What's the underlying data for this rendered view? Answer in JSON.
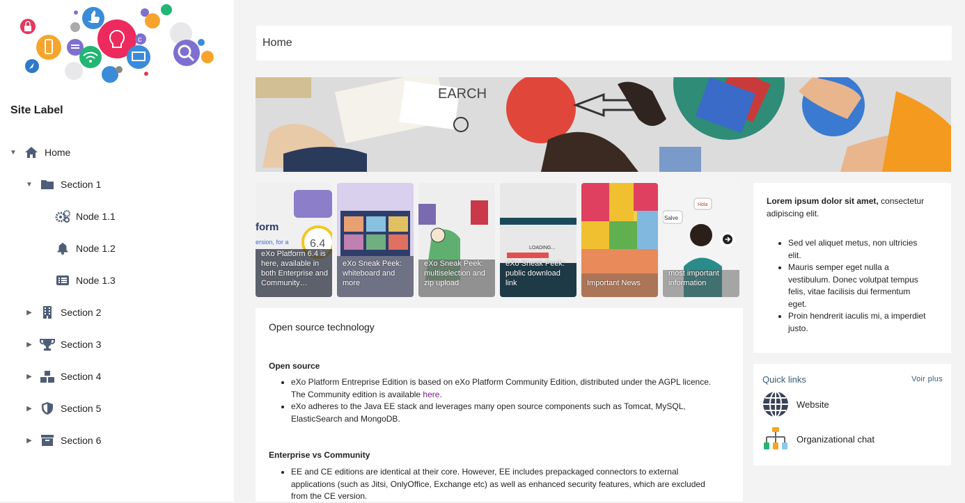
{
  "sidebar": {
    "site_label": "Site Label",
    "items": [
      {
        "label": "Home",
        "icon": "home-icon",
        "caret": "expanded"
      },
      {
        "label": "Section 1",
        "icon": "folder-icon",
        "caret": "expanded"
      },
      {
        "label": "Node 1.1",
        "icon": "gears-icon",
        "caret": "none"
      },
      {
        "label": "Node 1.2",
        "icon": "bell-icon",
        "caret": "none"
      },
      {
        "label": "Node 1.3",
        "icon": "list-icon",
        "caret": "none"
      },
      {
        "label": "Section 2",
        "icon": "building-icon",
        "caret": "collapsed"
      },
      {
        "label": "Section 3",
        "icon": "trophy-icon",
        "caret": "collapsed"
      },
      {
        "label": "Section 4",
        "icon": "boxes-icon",
        "caret": "collapsed"
      },
      {
        "label": "Section 5",
        "icon": "shield-icon",
        "caret": "collapsed"
      },
      {
        "label": "Section 6",
        "icon": "archive-icon",
        "caret": "collapsed"
      }
    ]
  },
  "page": {
    "title": "Home"
  },
  "news": [
    {
      "text": "eXo Platform 6.4 is here, available in both Enterprise and Community…",
      "overlay_text": [
        "form",
        "ersion, for a",
        "6.4"
      ]
    },
    {
      "text": "eXo Sneak Peek: whiteboard and more"
    },
    {
      "text": "eXo Sneak Peek: multiselection and zip upload"
    },
    {
      "text": "eXo Sneak Peek: public download link",
      "overlay_text": [
        "LOADING..."
      ]
    },
    {
      "text": "Important News"
    },
    {
      "text": "most important information",
      "overlay_text": [
        "Salve",
        "Hola"
      ]
    }
  ],
  "banner": {
    "overlay_text": "EARCH"
  },
  "article": {
    "title": "Open source technology",
    "h1": "Open source",
    "b1_pre": "eXo Platform Entreprise Edition is based on eXo Platform Community Edition, distributed under the AGPL licence. The Community edition is available ",
    "b1_link": "here",
    "b1_post": ".",
    "b2": "eXo adheres to the Java EE stack and leverages many open source components such as Tomcat, MySQL, ElasticSearch and MongoDB.",
    "h2": "Enterprise vs Community",
    "b3": "EE and CE editions are identical at their core. However, EE includes prepackaged connectors to external applications (such as Jitsi, OnlyOffice, Exchange etc) as well as enhanced security features, which are excluded from the CE version."
  },
  "lorem": {
    "bold": "Lorem ipsum dolor sit amet,",
    "rest": " consectetur adipiscing elit.",
    "items": [
      "Sed vel aliquet metus, non ultricies elit.",
      "Mauris semper eget nulla a vestibulum. Donec volutpat tempus felis, vitae facilisis dui fermentum eget.",
      "Proin hendrerit iaculis mi, a imperdiet justo."
    ]
  },
  "quick_links": {
    "title": "Quick links",
    "more": "Voir plus",
    "items": [
      {
        "label": "Website",
        "icon": "globe-icon"
      },
      {
        "label": "Organizational chat",
        "icon": "org-chart-icon"
      }
    ]
  },
  "colors": {
    "accent": "#3a5a78",
    "link": "#7a1a8a",
    "icon": "#4e5d78"
  }
}
